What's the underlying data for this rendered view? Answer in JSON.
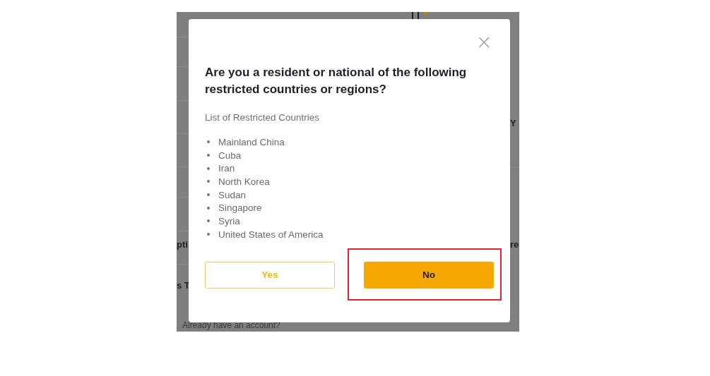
{
  "background": {
    "left_fragments": [
      "pti",
      "s T"
    ],
    "right_fragments": [
      "Y",
      "re"
    ],
    "footer_text": "Already have an account?"
  },
  "dialog": {
    "close_label": "×",
    "title": "Are you a resident or national of the following restricted countries or regions?",
    "list_label": "List of Restricted Countries",
    "countries": [
      "Mainland China",
      "Cuba",
      "Iran",
      "North Korea",
      "Sudan",
      "Singapore",
      "Syria",
      "United States of America"
    ],
    "buttons": [
      {
        "label": "Yes",
        "kind": "outline",
        "highlighted": false
      },
      {
        "label": "No",
        "kind": "filled",
        "highlighted": true
      }
    ]
  }
}
